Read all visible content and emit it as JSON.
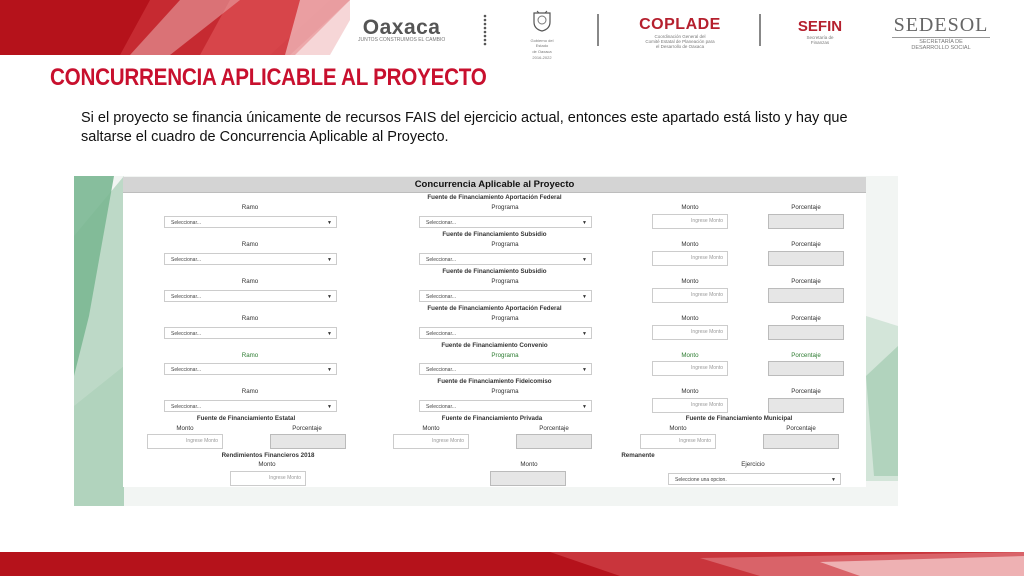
{
  "logos": {
    "oaxaca": {
      "name": "Oaxaca",
      "tagline": "JUNTOS CONSTRUIMOS EL CAMBIO"
    },
    "gobierno": {
      "caption_line1": "Gobierno del Estado",
      "caption_line2": "de Oaxaca",
      "years": "2016-2022"
    },
    "coplade": {
      "name": "COPLADE",
      "line1": "Coordinación General del",
      "line2": "Comité Estatal de Planeación para",
      "line3": "el Desarrollo de Oaxaca"
    },
    "sefin": {
      "name": "SEFIN",
      "line1": "Secretaría de",
      "line2": "Finanzas"
    },
    "sedesol": {
      "name": "SEDESOL",
      "line1": "SECRETARÍA DE",
      "line2": "DESARROLLO SOCIAL"
    }
  },
  "page": {
    "title": "CONCURRENCIA APLICABLE AL PROYECTO",
    "intro_line1": "Si el proyecto se financia únicamente de recursos FAIS del ejercicio actual, entonces este apartado está listo y hay que",
    "intro_line2": "saltarse el cuadro de Concurrencia Aplicable al Proyecto."
  },
  "form": {
    "title": "Concurrencia Aplicable al Proyecto",
    "col_ramo": "Ramo",
    "col_programa": "Programa",
    "col_monto": "Monto",
    "col_porcentaje": "Porcentaje",
    "select_placeholder": "Seleccionar...",
    "monto_placeholder": "Ingrese Monto",
    "sections": [
      {
        "source": "Fuente de Financiamiento Aportación Federal"
      },
      {
        "source": "Fuente de Financiamiento Subsidio"
      },
      {
        "source": "Fuente de Financiamiento Subsidio"
      },
      {
        "source": "Fuente de Financiamiento Aportación Federal"
      },
      {
        "source": "Fuente de Financiamiento Convenio"
      },
      {
        "source": "Fuente de Financiamiento Fideicomiso"
      }
    ],
    "estatal": "Fuente de Financiamiento Estatal",
    "privada": "Fuente de Financiamiento Privada",
    "municipal": "Fuente de Financiamiento Municipal",
    "rendimientos": "Rendimientos Financieros 2018",
    "remanente": "Remanente",
    "ejercicio": "Ejercicio",
    "ejercicio_placeholder": "Seleccione una opcion."
  },
  "colors": {
    "accent_red": "#c8102e",
    "header_grey": "#d4d4d4",
    "deco_green": "#7cb892",
    "highlight_green": "#2e7d32"
  }
}
